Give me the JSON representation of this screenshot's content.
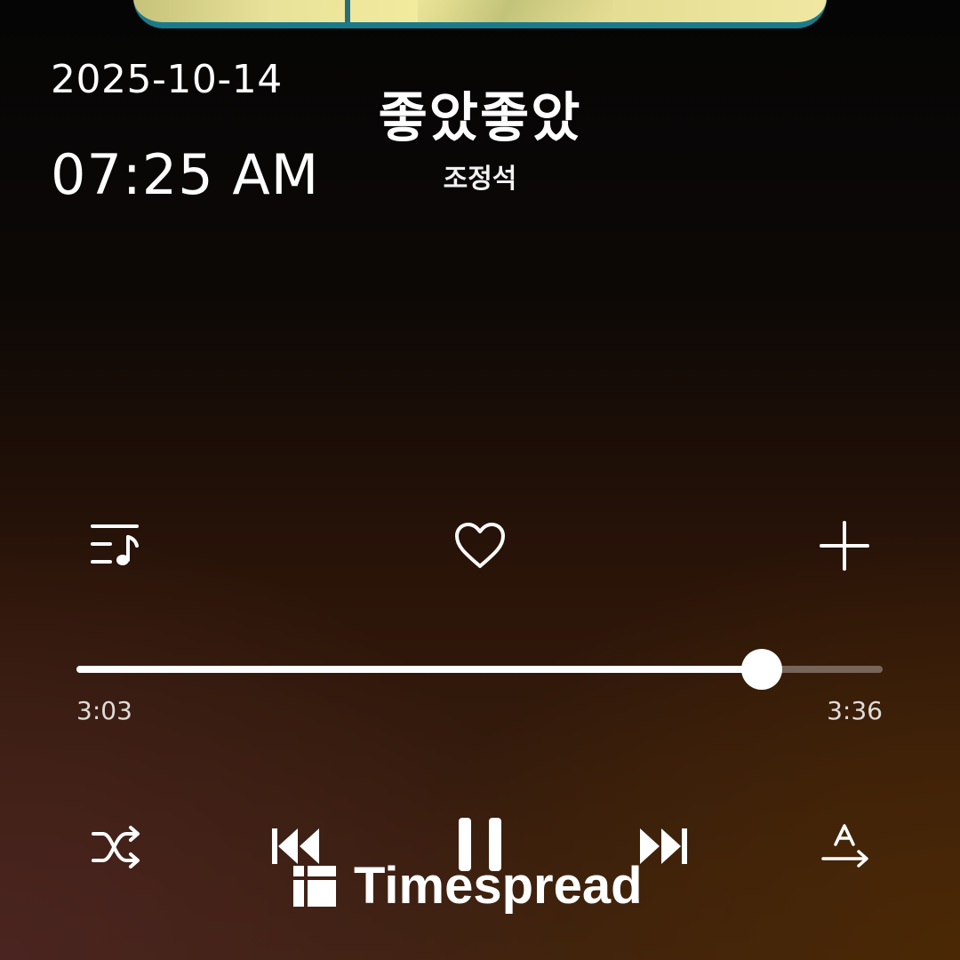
{
  "clock": {
    "date": "2025-10-14",
    "time": "07:25 AM"
  },
  "track": {
    "title": "좋았좋았",
    "artist": "조정석"
  },
  "playback": {
    "elapsed": "3:03",
    "duration": "3:36",
    "progress_fraction": 0.85,
    "state": "playing"
  },
  "actions": {
    "queue_icon": "playlist-music-icon",
    "like_icon": "heart-outline-icon",
    "add_icon": "plus-icon"
  },
  "controls": {
    "shuffle_icon": "shuffle-icon",
    "previous_icon": "skip-previous-icon",
    "play_pause_icon": "pause-icon",
    "next_icon": "skip-next-icon",
    "lyrics_translate_icon": "translate-icon"
  },
  "watermark": {
    "text": "Timespread"
  },
  "colors": {
    "accent": "#ffffff",
    "track_inactive": "#5e5149",
    "album_border": "#1a7a8c"
  }
}
